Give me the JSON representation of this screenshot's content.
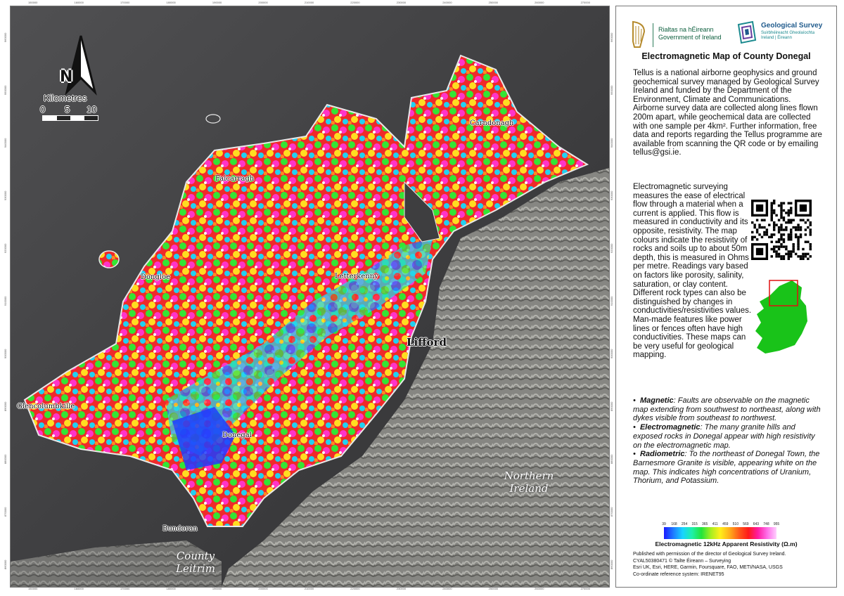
{
  "map": {
    "north_label": "N",
    "scale_title": "Kilometres",
    "scale_ticks": [
      "0",
      "5",
      "10"
    ],
    "towns": [
      {
        "name": "Carndonagh",
        "size": "small"
      },
      {
        "name": "Falcarragh",
        "size": "small"
      },
      {
        "name": "Dongloe",
        "size": "small"
      },
      {
        "name": "Letterkenny",
        "size": "small"
      },
      {
        "name": "Lifford",
        "size": "big"
      },
      {
        "name": "Glencolumbkille",
        "size": "small"
      },
      {
        "name": "Donegal",
        "size": "small"
      },
      {
        "name": "Bundoran",
        "size": "small"
      }
    ],
    "regions": [
      {
        "name": "Northern Ireland"
      },
      {
        "name": "County Leitrim"
      }
    ],
    "axis_ticks_x": [
      "150000",
      "160000",
      "170000",
      "180000",
      "190000",
      "200000",
      "210000",
      "220000",
      "230000",
      "240000",
      "250000",
      "260000",
      "270000"
    ],
    "axis_ticks_y": [
      "960000",
      "950000",
      "940000",
      "930000",
      "920000",
      "910000",
      "900000",
      "890000",
      "880000",
      "870000",
      "860000"
    ]
  },
  "panel": {
    "gov_logo_line1": "Rialtas na hÉireann",
    "gov_logo_line2": "Government of Ireland",
    "gsi_name": "Geological Survey",
    "gsi_sub1": "Suirbhéireacht Gheolaíochta",
    "gsi_sub2": "Ireland | Éireann",
    "title": "Electromagnetic Map of County Donegal",
    "intro": "Tellus is a national airborne geophysics and ground geochemical survey managed by Geological Survey Ireland and funded by the Department of the Environment, Climate and Communications. Airborne survey data are collected along lines flown 200m apart, while geochemical data are collected with one sample per 4km². Further information, free data and reports regarding the Tellus programme are available from scanning the QR code or by emailing tellus@gsi.ie.",
    "body": "Electromagnetic surveying measures the ease of electrical flow through a material when a current is applied. This flow is measured in conductivity and its opposite, resistivity. The map colours indicate the resistivity of rocks and soils up to about 50m depth, this is measured in Ohms per metre. Readings vary based on factors like porosity, salinity, saturation, or clay content. Different rock types can also be distinguished by changes in conductivities/resistivities values. Man-made features like power lines or fences often have high conductivities. These maps can be very useful for geological mapping.",
    "bullets": [
      {
        "head": "Magnetic",
        "text": ": Faults are observable on the magnetic map extending from southwest to northeast, along with dykes visible from southeast to northwest."
      },
      {
        "head": "Electromagnetic",
        "text": ": The many granite hills and exposed rocks in Donegal appear with high resistivity on the electromagnetic map."
      },
      {
        "head": "Radiometric",
        "text": ": To the northeast of Donegal Town, the Barnesmore Granite is visible, appearing white on the map. This indicates high concentrations of Uranium, Thorium, and Potassium."
      }
    ],
    "legend_ticks": [
      "39",
      "168",
      "254",
      "315",
      "365",
      "411",
      "459",
      "510",
      "569",
      "643",
      "748",
      "955"
    ],
    "legend_title": "Electromagnetic 12kHz Apparent Resistivity (Ω.m)",
    "credits": [
      "Published with permission of the director of Geological Survey Ireland.",
      "CYAL50380471 © Tailte Éireann – Surveying",
      "Esri UK, Esri, HERE, Garmin, Foursquare, FAO, METI/NASA, USGS",
      "Co-ordinate reference system: IRENET95"
    ],
    "accent_color": "#1f5a8c",
    "ireland_fill": "#19c319",
    "inset_box_color": "#e01010"
  }
}
